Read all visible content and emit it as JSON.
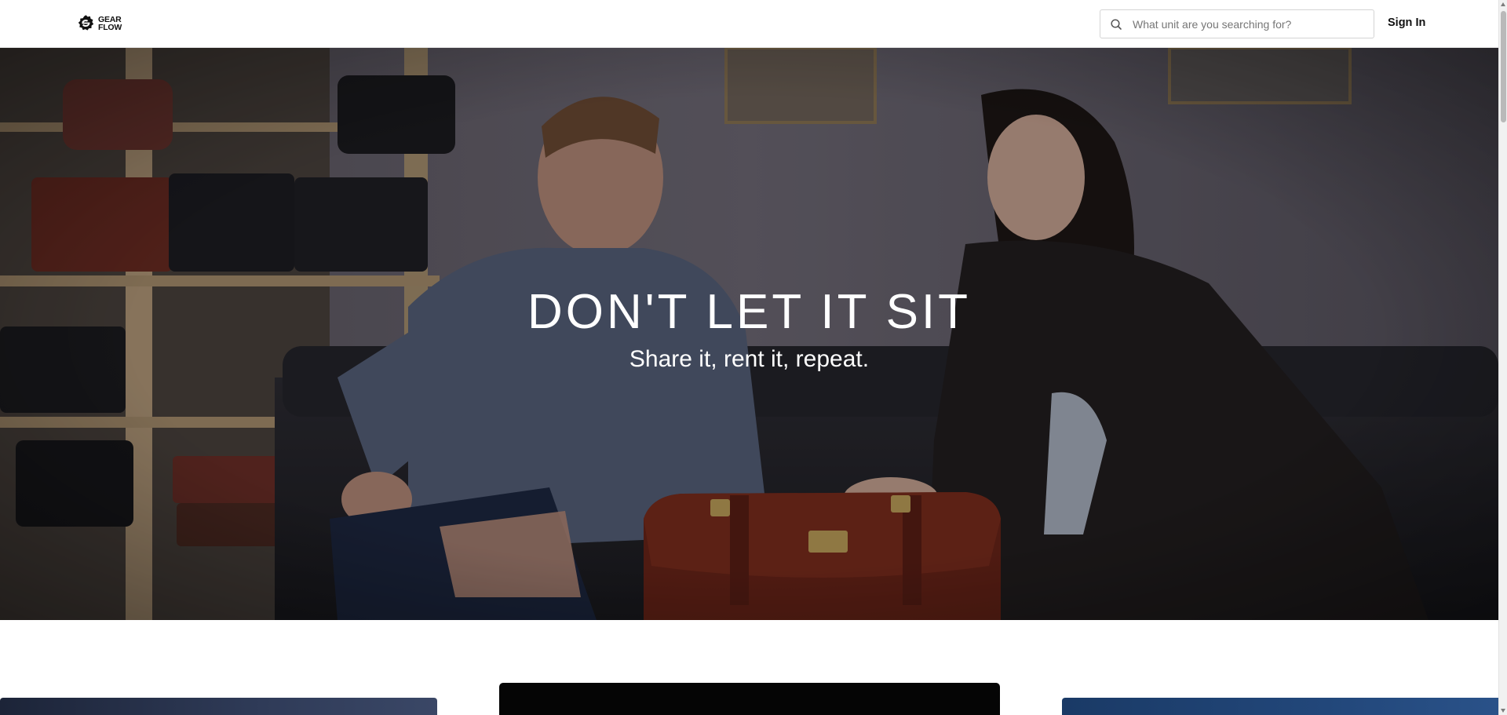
{
  "header": {
    "logo": {
      "line1": "GEAR",
      "line2": "FLOW",
      "icon": "gearflow-logo-icon"
    },
    "search": {
      "icon": "search-icon",
      "placeholder": "What unit are you searching for?",
      "value": ""
    },
    "sign_in_label": "Sign In"
  },
  "hero": {
    "title": "DON'T LET IT SIT",
    "subtitle": "Share it, rent it, repeat.",
    "overlay_color": "#000000"
  },
  "cards": [
    {
      "id": "left"
    },
    {
      "id": "center"
    },
    {
      "id": "right"
    }
  ],
  "colors": {
    "text_primary": "#111111",
    "border": "#d4d4d4",
    "hero_text": "#ffffff"
  }
}
